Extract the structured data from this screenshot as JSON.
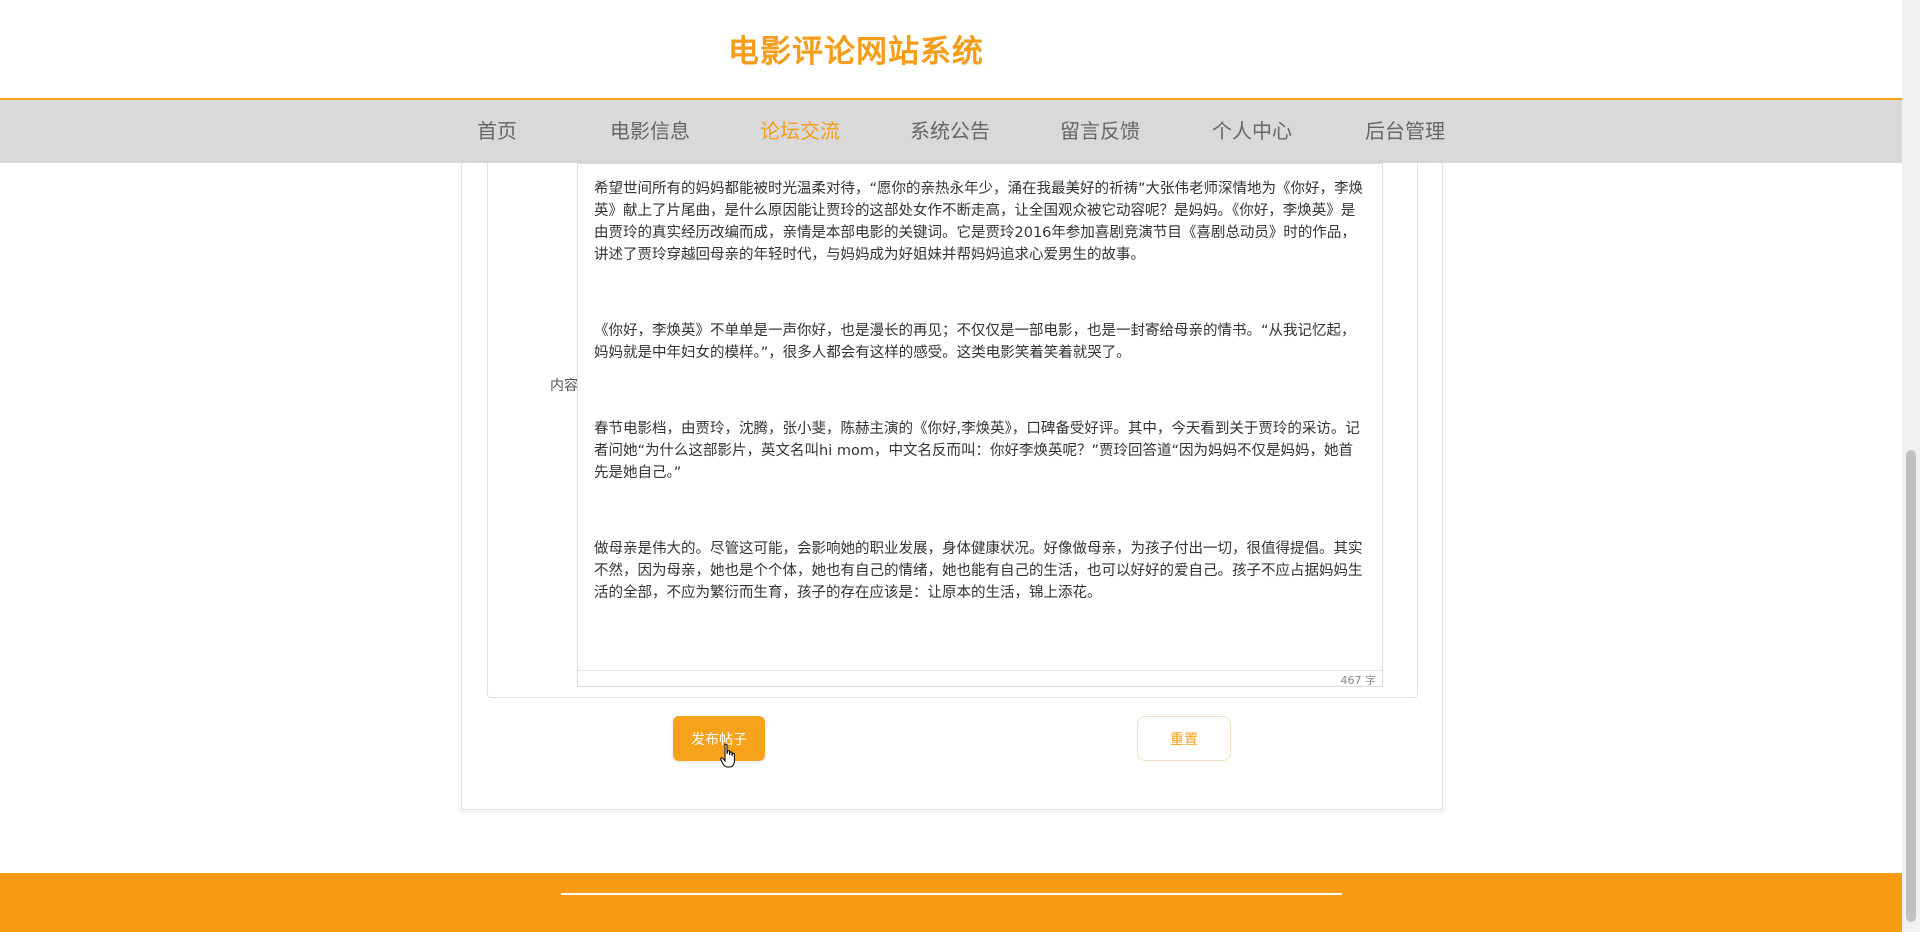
{
  "site": {
    "title": "电影评论网站系统"
  },
  "nav": {
    "items": [
      {
        "label": "首页"
      },
      {
        "label": "电影信息"
      },
      {
        "label": "论坛交流"
      },
      {
        "label": "系统公告"
      },
      {
        "label": "留言反馈"
      },
      {
        "label": "个人中心"
      },
      {
        "label": "后台管理"
      }
    ],
    "active": "论坛交流"
  },
  "form": {
    "content_label": "内容:",
    "content_paragraphs": [
      "希望世间所有的妈妈都能被时光温柔对待，“愿你的亲热永年少，涌在我最美好的祈祷”大张伟老师深情地为《你好，李焕英》献上了片尾曲，是什么原因能让贾玲的这部处女作不断走高，让全国观众被它动容呢？是妈妈。《你好，李焕英》是由贾玲的真实经历改编而成，亲情是本部电影的关键词。它是贾玲2016年参加喜剧竞演节目《喜剧总动员》时的作品，讲述了贾玲穿越回母亲的年轻时代，与妈妈成为好姐妹并帮妈妈追求心爱男生的故事。",
      "《你好，李焕英》不单单是一声你好，也是漫长的再见；不仅仅是一部电影，也是一封寄给母亲的情书。“从我记忆起，妈妈就是中年妇女的模样。”，很多人都会有这样的感受。这类电影笑着笑着就哭了。",
      "春节电影档，由贾玲，沈腾，张小斐，陈赫主演的《你好,李焕英》，口碑备受好评。其中，今天看到关于贾玲的采访。记者问她“为什么这部影片，英文名叫hi mom，中文名反而叫：你好李焕英呢？”贾玲回答道“因为妈妈不仅是妈妈，她首先是她自己。”",
      "做母亲是伟大的。尽管这可能，会影响她的职业发展，身体健康状况。好像做母亲，为孩子付出一切，很值得提倡。其实不然，因为母亲，她也是个个体，她也有自己的情绪，她也能有自己的生活，也可以好好的爱自己。孩子不应占据妈妈生活的全部，不应为繁衍而生育，孩子的存在应该是：让原本的生活，锦上添花。"
    ],
    "word_count": "467 字",
    "publish_label": "发布帖子",
    "reset_label": "重置"
  },
  "colors": {
    "accent": "#f7a21b",
    "nav_bg": "#d9d9d9",
    "footer": "#f99b12"
  }
}
